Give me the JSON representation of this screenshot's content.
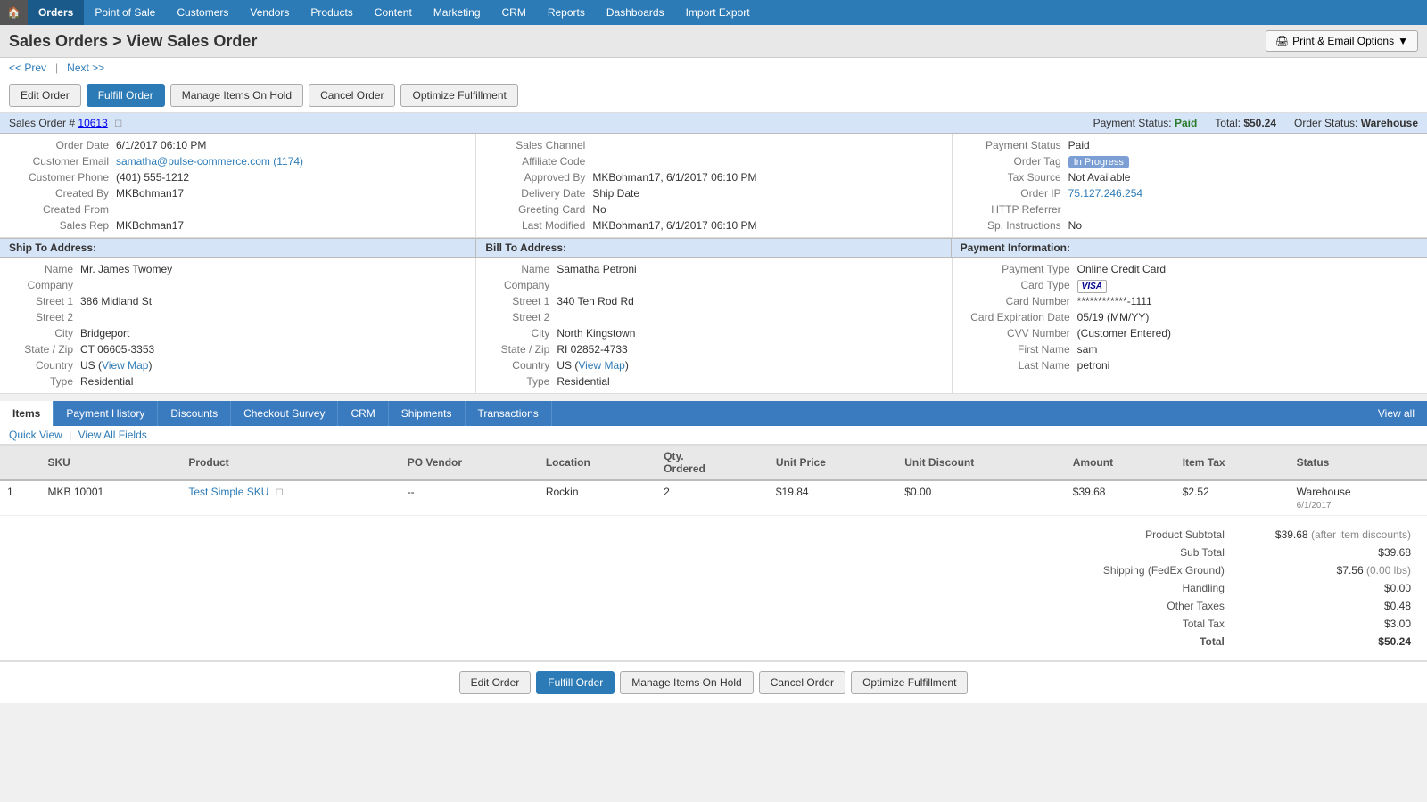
{
  "nav": {
    "home_icon": "🏠",
    "items": [
      {
        "label": "Orders",
        "active": true
      },
      {
        "label": "Point of Sale",
        "active": false
      },
      {
        "label": "Customers",
        "active": false
      },
      {
        "label": "Vendors",
        "active": false
      },
      {
        "label": "Products",
        "active": false
      },
      {
        "label": "Content",
        "active": false
      },
      {
        "label": "Marketing",
        "active": false
      },
      {
        "label": "CRM",
        "active": false
      },
      {
        "label": "Reports",
        "active": false
      },
      {
        "label": "Dashboards",
        "active": false
      },
      {
        "label": "Import Export",
        "active": false
      }
    ]
  },
  "header": {
    "title": "Sales Orders > View Sales Order",
    "print_label": "Print & Email Options",
    "print_icon": "🖨"
  },
  "breadcrumb": {
    "prev_label": "<< Prev",
    "next_label": "Next >>"
  },
  "action_buttons": {
    "edit_order": "Edit Order",
    "fulfill_order": "Fulfill Order",
    "manage_hold": "Manage Items On Hold",
    "cancel_order": "Cancel Order",
    "optimize": "Optimize Fulfillment"
  },
  "order": {
    "id_label": "Sales Order #",
    "id": "10613",
    "payment_status_label": "Payment Status:",
    "payment_status": "Paid",
    "total_label": "Total:",
    "total": "$50.24",
    "order_status_label": "Order Status:",
    "order_status": "Warehouse"
  },
  "order_fields": {
    "left": [
      {
        "label": "Order Date",
        "value": "6/1/2017 06:10 PM"
      },
      {
        "label": "Customer Email",
        "value": "samatha@pulse-commerce.com",
        "link": true,
        "extra": "(1174)"
      },
      {
        "label": "Customer Phone",
        "value": "(401) 555-1212"
      },
      {
        "label": "Created By",
        "value": "MKBohman17"
      },
      {
        "label": "Created From",
        "value": ""
      },
      {
        "label": "Sales Rep",
        "value": "MKBohman17"
      }
    ],
    "middle": [
      {
        "label": "Sales Channel",
        "value": ""
      },
      {
        "label": "Affiliate Code",
        "value": ""
      },
      {
        "label": "Approved By",
        "value": "MKBohman17, 6/1/2017 06:10 PM"
      },
      {
        "label": "Delivery Date",
        "value": "Ship Date"
      },
      {
        "label": "Greeting Card",
        "value": "No"
      },
      {
        "label": "Last Modified",
        "value": "MKBohman17, 6/1/2017 06:10 PM"
      }
    ],
    "right": [
      {
        "label": "Payment Status",
        "value": "Paid"
      },
      {
        "label": "Order Tag",
        "value": "In Progress",
        "tag": true
      },
      {
        "label": "Tax Source",
        "value": "Not Available"
      },
      {
        "label": "Order IP",
        "value": "75.127.246.254",
        "link": true
      },
      {
        "label": "HTTP Referrer",
        "value": ""
      },
      {
        "label": "Sp. Instructions",
        "value": "No"
      }
    ]
  },
  "address": {
    "ship_to": {
      "header": "Ship To Address:",
      "fields": [
        {
          "label": "Name",
          "value": "Mr. James Twomey"
        },
        {
          "label": "Company",
          "value": ""
        },
        {
          "label": "Street 1",
          "value": "386 Midland St"
        },
        {
          "label": "Street 2",
          "value": ""
        },
        {
          "label": "City",
          "value": "Bridgeport"
        },
        {
          "label": "State / Zip",
          "value": "CT 06605-3353"
        },
        {
          "label": "Country",
          "value": "US (View Map)",
          "link": true
        },
        {
          "label": "Type",
          "value": "Residential"
        }
      ]
    },
    "bill_to": {
      "header": "Bill To Address:",
      "fields": [
        {
          "label": "Name",
          "value": "Samatha Petroni"
        },
        {
          "label": "Company",
          "value": ""
        },
        {
          "label": "Street 1",
          "value": "340 Ten Rod Rd"
        },
        {
          "label": "Street 2",
          "value": ""
        },
        {
          "label": "City",
          "value": "North Kingstown"
        },
        {
          "label": "State / Zip",
          "value": "RI 02852-4733"
        },
        {
          "label": "Country",
          "value": "US (View Map)",
          "link": true
        },
        {
          "label": "Type",
          "value": "Residential"
        }
      ]
    },
    "payment_info": {
      "header": "Payment Information:",
      "fields": [
        {
          "label": "Payment Type",
          "value": "Online Credit Card"
        },
        {
          "label": "Card Type",
          "value": "VISA",
          "visa": true
        },
        {
          "label": "Card Number",
          "value": "************-1111"
        },
        {
          "label": "Card Expiration Date",
          "value": "05/19 (MM/YY)"
        },
        {
          "label": "CVV Number",
          "value": "(Customer Entered)"
        },
        {
          "label": "First Name",
          "value": "sam"
        },
        {
          "label": "Last Name",
          "value": "petroni"
        }
      ]
    }
  },
  "tabs": {
    "items": [
      {
        "label": "Items",
        "active": true
      },
      {
        "label": "Payment History",
        "active": false
      },
      {
        "label": "Discounts",
        "active": false
      },
      {
        "label": "Checkout Survey",
        "active": false
      },
      {
        "label": "CRM",
        "active": false
      },
      {
        "label": "Shipments",
        "active": false
      },
      {
        "label": "Transactions",
        "active": false
      }
    ],
    "view_all": "View all"
  },
  "quick_view": {
    "label": "Quick View",
    "separator": "|",
    "view_all": "View All Fields"
  },
  "table": {
    "headers": [
      "",
      "SKU",
      "Product",
      "PO Vendor",
      "Location",
      "Qty. Ordered",
      "Unit Price",
      "Unit Discount",
      "Amount",
      "Item Tax",
      "Status"
    ],
    "rows": [
      {
        "num": "1",
        "sku": "MKB 10001",
        "product": "Test Simple SKU",
        "po_vendor": "--",
        "location": "Rockin",
        "qty": "2",
        "unit_price": "$19.84",
        "unit_discount": "$0.00",
        "amount": "$39.68",
        "item_tax": "$2.52",
        "status": "Warehouse",
        "status_date": "6/1/2017"
      }
    ]
  },
  "totals": {
    "product_subtotal_label": "Product Subtotal",
    "product_subtotal": "$39.68",
    "product_subtotal_note": "(after item discounts)",
    "subtotal_label": "Sub Total",
    "subtotal": "$39.68",
    "shipping_label": "Shipping (FedEx Ground)",
    "shipping": "$7.56",
    "shipping_note": "(0.00 lbs)",
    "handling_label": "Handling",
    "handling": "$0.00",
    "other_taxes_label": "Other Taxes",
    "other_taxes": "$0.48",
    "total_tax_label": "Total Tax",
    "total_tax": "$3.00",
    "total_label": "Total",
    "total": "$50.24"
  },
  "colors": {
    "primary_blue": "#2c7bb6",
    "nav_bg": "#2c7bb6",
    "paid_green": "#2a7a2a",
    "header_bg": "#d6e4f7"
  }
}
